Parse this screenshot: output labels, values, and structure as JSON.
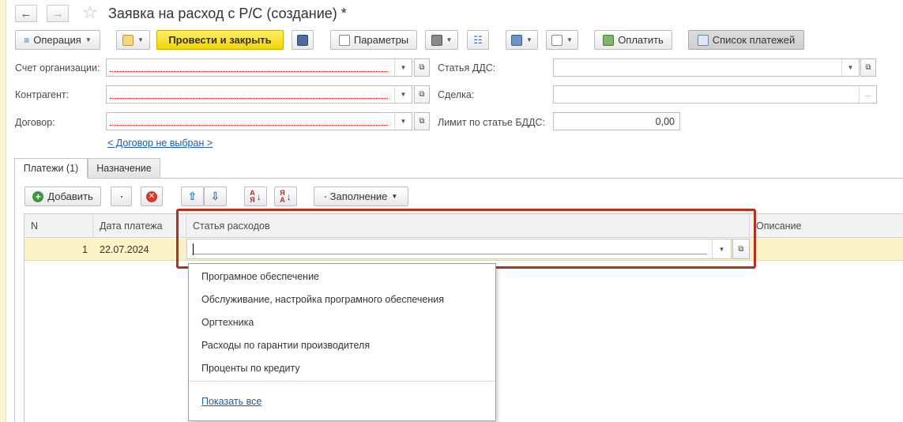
{
  "window": {
    "title": "Заявка на расход с Р/С (создание) *"
  },
  "toolbar": {
    "operation_label": "Операция",
    "post_close_label": "Провести и закрыть",
    "params_label": "Параметры",
    "pay_label": "Оплатить",
    "payment_list_label": "Список платежей"
  },
  "form": {
    "org_account_label": "Счет организации:",
    "counterparty_label": "Контрагент:",
    "contract_label": "Договор:",
    "dds_label": "Статья ДДС:",
    "deal_label": "Сделка:",
    "limit_label": "Лимит по статье БДДС:",
    "limit_value": "0,00",
    "contract_link": "< Договор не выбран >"
  },
  "tabs": [
    {
      "label": "Платежи (1)",
      "active": true
    },
    {
      "label": "Назначение",
      "active": false
    }
  ],
  "table_toolbar": {
    "add_label": "Добавить",
    "fill_label": "Заполнение"
  },
  "grid": {
    "columns": [
      "N",
      "Дата платежа",
      "Статья расходов",
      "Описание"
    ],
    "rows": [
      {
        "n": "1",
        "date": "22.07.2024",
        "expense_item": "",
        "description": ""
      }
    ]
  },
  "dropdown": {
    "items": [
      "Програмное обеспечение",
      "Обслуживание, настройка програмного обеспечения",
      "Оргтехника",
      "Расходы по гарантии производителя",
      "Проценты по кредиту"
    ],
    "show_all": "Показать все"
  },
  "colors": {
    "primary_button": "#f2d400",
    "highlight_border": "#b2331c",
    "selected_row": "#fbf1c4",
    "link": "#1c5ba8"
  }
}
